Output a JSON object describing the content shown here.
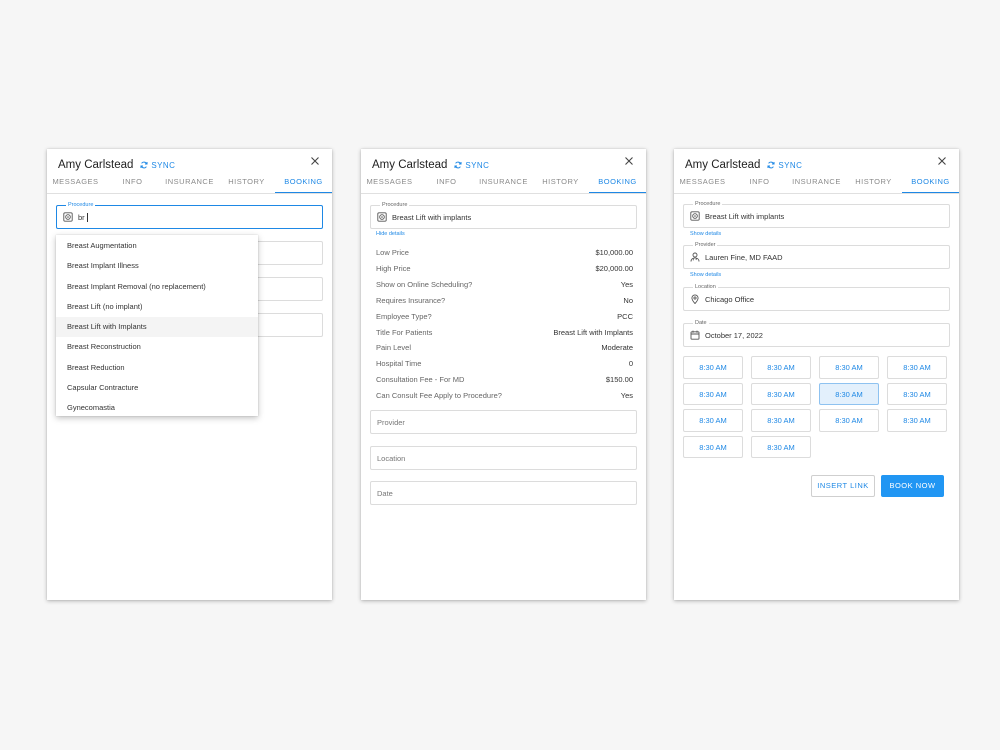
{
  "panels": [
    {
      "patient_name": "Amy Carlstead",
      "sync_label": "SYNC",
      "tabs": [
        "MESSAGES",
        "INFO",
        "INSURANCE",
        "HISTORY",
        "BOOKING"
      ],
      "procedure": {
        "label": "Procedure",
        "value": "br"
      },
      "dropdown_options": [
        "Breast Augmentation",
        "Breast Implant Illness",
        "Breast Implant Removal (no replacement)",
        "Breast Lift (no implant)",
        "Breast Lift with Implants",
        "Breast Reconstruction",
        "Breast Reduction",
        "Capsular Contracture",
        "Gynecomastia"
      ],
      "highlighted_option": "Breast Lift with Implants"
    },
    {
      "patient_name": "Amy Carlstead",
      "sync_label": "SYNC",
      "tabs": [
        "MESSAGES",
        "INFO",
        "INSURANCE",
        "HISTORY",
        "BOOKING"
      ],
      "procedure": {
        "label": "Procedure",
        "value": "Breast Lift with implants"
      },
      "hide_details_label": "Hide details",
      "details": [
        {
          "key": "Low Price",
          "value": "$10,000.00"
        },
        {
          "key": "High Price",
          "value": "$20,000.00"
        },
        {
          "key": "Show on Online Scheduling?",
          "value": "Yes"
        },
        {
          "key": "Requires Insurance?",
          "value": "No"
        },
        {
          "key": "Employee Type?",
          "value": "PCC"
        },
        {
          "key": "Title For Patients",
          "value": "Breast Lift with Implants"
        },
        {
          "key": "Pain Level",
          "value": "Moderate"
        },
        {
          "key": "Hospital Time",
          "value": "0"
        },
        {
          "key": "Consultation Fee - For MD",
          "value": "$150.00"
        },
        {
          "key": "Can Consult Fee Apply to Procedure?",
          "value": "Yes"
        }
      ],
      "provider_placeholder": "Provider",
      "location_placeholder": "Location",
      "date_placeholder": "Date"
    },
    {
      "patient_name": "Amy Carlstead",
      "sync_label": "SYNC",
      "tabs": [
        "MESSAGES",
        "INFO",
        "INSURANCE",
        "HISTORY",
        "BOOKING"
      ],
      "procedure": {
        "label": "Procedure",
        "value": "Breast Lift with implants"
      },
      "show_details_label": "Show details",
      "provider": {
        "label": "Provider",
        "value": "Lauren Fine, MD FAAD"
      },
      "location": {
        "label": "Location",
        "value": "Chicago Office"
      },
      "date": {
        "label": "Date",
        "value": "October 17, 2022"
      },
      "time_slots": [
        "8:30 AM",
        "8:30 AM",
        "8:30 AM",
        "8:30 AM",
        "8:30 AM",
        "8:30 AM",
        "8:30 AM",
        "8:30 AM",
        "8:30 AM",
        "8:30 AM",
        "8:30 AM",
        "8:30 AM",
        "8:30 AM",
        "8:30 AM"
      ],
      "selected_slot_index": 6,
      "insert_link_label": "INSERT LINK",
      "book_now_label": "BOOK NOW"
    }
  ],
  "colors": {
    "accent": "#1e88e5",
    "primary_button": "#2196f3",
    "selected_slot_bg": "#e3f0fc"
  },
  "icons": {
    "sync": "sync-icon",
    "close": "close-icon",
    "procedure": "procedure-icon",
    "provider": "doctor-icon",
    "location": "location-pin-icon",
    "date": "calendar-icon"
  }
}
